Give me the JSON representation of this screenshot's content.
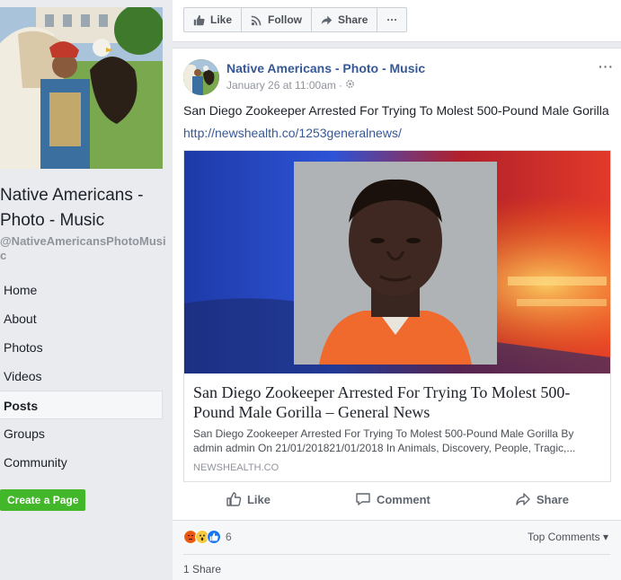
{
  "page": {
    "name": "Native Americans - Photo - Music",
    "handle": "@NativeAmericansPhotoMusic"
  },
  "sidebar": {
    "items": [
      {
        "label": "Home"
      },
      {
        "label": "About"
      },
      {
        "label": "Photos"
      },
      {
        "label": "Videos"
      },
      {
        "label": "Posts",
        "active": true
      },
      {
        "label": "Groups"
      },
      {
        "label": "Community"
      }
    ],
    "create_page_label": "Create a Page"
  },
  "topbar": {
    "like_label": "Like",
    "follow_label": "Follow",
    "share_label": "Share",
    "more_label": "···"
  },
  "post": {
    "author": "Native Americans - Photo - Music",
    "timestamp": "January 26 at 11:00am",
    "privacy_icon": "public-gear-icon",
    "options_label": "···",
    "text": "San Diego Zookeeper Arrested For Trying To Molest 500-Pound Male Gorilla",
    "link": "http://newshealth.co/1253generalnews/",
    "link_card": {
      "title": "San Diego Zookeeper Arrested For Trying To Molest 500-Pound Male Gorilla – General News",
      "description": "San Diego Zookeeper Arrested For Trying To Molest 500-Pound Male Gorilla By admin admin On 21/01/201821/01/2018 In Animals, Discovery, People, Tragic,...",
      "domain": "NEWSHEALTH.CO"
    },
    "actions": {
      "like": "Like",
      "comment": "Comment",
      "share": "Share"
    },
    "reactions": {
      "count": "6",
      "types": [
        "angry",
        "wow",
        "like"
      ]
    },
    "top_comments_label": "Top Comments ▾",
    "shares_label": "1 Share"
  },
  "colors": {
    "link": "#365899",
    "background": "#e9ebee",
    "create_page": "#42b72a"
  }
}
